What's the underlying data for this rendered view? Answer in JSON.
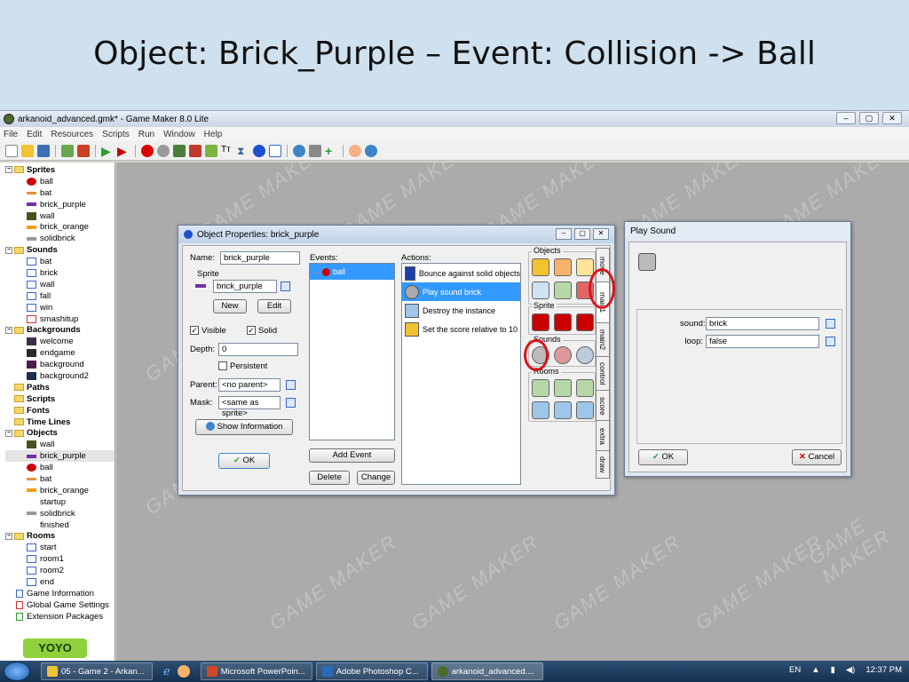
{
  "slide": {
    "title": "Object: Brick_Purple – Event: Collision -> Ball"
  },
  "window": {
    "title": "arkanoid_advanced.gmk* - Game Maker 8.0 Lite",
    "controls": [
      "–",
      "▢",
      "✕"
    ],
    "menu": [
      "File",
      "Edit",
      "Resources",
      "Scripts",
      "Run",
      "Window",
      "Help"
    ]
  },
  "tree": {
    "sprites": {
      "label": "Sprites",
      "items": [
        "ball",
        "bat",
        "brick_purple",
        "wall",
        "brick_orange",
        "solidbrick"
      ]
    },
    "sounds": {
      "label": "Sounds",
      "items": [
        "bat",
        "brick",
        "wall",
        "fall",
        "win",
        "smashitup"
      ]
    },
    "backgrounds": {
      "label": "Backgrounds",
      "items": [
        "welcome",
        "endgame",
        "background",
        "background2"
      ]
    },
    "paths": "Paths",
    "scripts": "Scripts",
    "fonts": "Fonts",
    "timelines": "Time Lines",
    "objects": {
      "label": "Objects",
      "items": [
        "wall",
        "brick_purple",
        "ball",
        "bat",
        "brick_orange",
        "startup",
        "solidbrick",
        "finished"
      ]
    },
    "rooms": {
      "label": "Rooms",
      "items": [
        "start",
        "room1",
        "room2",
        "end"
      ]
    },
    "extras": [
      "Game Information",
      "Global Game Settings",
      "Extension Packages"
    ],
    "logo_text": "YOYO GAMES"
  },
  "watermark": "GAME MAKER",
  "obj_dialog": {
    "title": "Object Properties: brick_purple",
    "name_label": "Name:",
    "name_value": "brick_purple",
    "sprite_label": "Sprite",
    "sprite_value": "brick_purple",
    "new_button": "New",
    "edit_button": "Edit",
    "visible_label": "Visible",
    "solid_label": "Solid",
    "depth_label": "Depth:",
    "depth_value": "0",
    "persistent_label": "Persistent",
    "parent_label": "Parent:",
    "parent_value": "<no parent>",
    "mask_label": "Mask:",
    "mask_value": "<same as sprite>",
    "show_info_button": "Show Information",
    "ok_button": "OK",
    "events_label": "Events:",
    "events": [
      "ball"
    ],
    "add_event_button": "Add Event",
    "delete_button": "Delete",
    "change_button": "Change",
    "actions_label": "Actions:",
    "actions": [
      "Bounce against solid objects",
      "Play sound brick",
      "Destroy the instance",
      "Set the score relative to 10"
    ],
    "groups": {
      "objects": "Objects",
      "sprite": "Sprite",
      "sounds": "Sounds",
      "rooms": "Rooms"
    },
    "tabs": [
      "move",
      "main1",
      "main2",
      "control",
      "score",
      "extra",
      "draw"
    ]
  },
  "sound_dialog": {
    "title": "Play Sound",
    "sound_label": "sound:",
    "sound_value": "brick",
    "loop_label": "loop:",
    "loop_value": "false",
    "ok_button": "OK",
    "cancel_button": "Cancel"
  },
  "taskbar": {
    "tasks": [
      "05 - Game 2 - Arkan...",
      "Microsoft PowerPoin...",
      "Adobe Photoshop C...",
      "arkanoid_advanced...."
    ],
    "lang": "EN",
    "time": "12:37 PM"
  },
  "colors": {
    "selection": "#3399ff",
    "highlight_ring": "#d8151b",
    "slide_bg": "#cfe0ee"
  }
}
